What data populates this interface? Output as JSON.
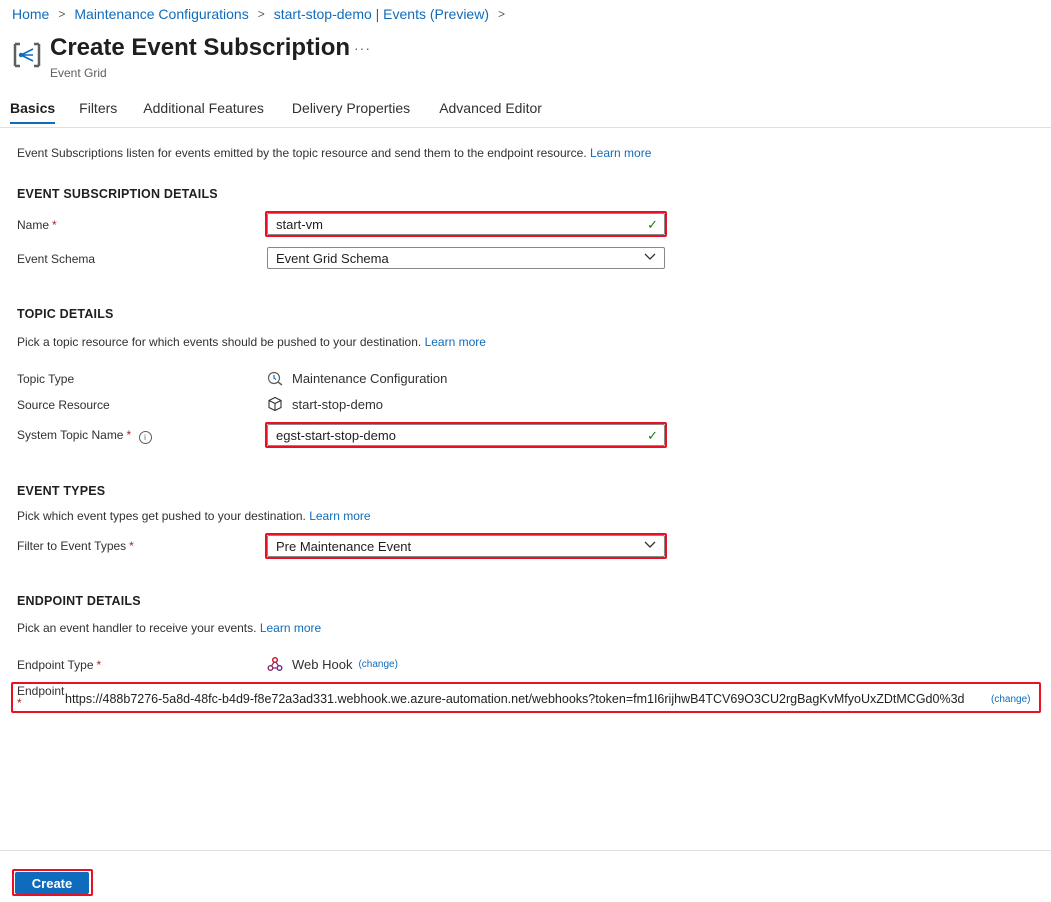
{
  "breadcrumb": [
    "Home",
    "Maintenance Configurations",
    "start-stop-demo | Events (Preview)"
  ],
  "header": {
    "title": "Create Event Subscription",
    "subtitle": "Event Grid",
    "more": "···"
  },
  "tabs": [
    "Basics",
    "Filters",
    "Additional Features",
    "Delivery Properties",
    "Advanced Editor"
  ],
  "intro": {
    "text": "Event Subscriptions listen for events emitted by the topic resource and send them to the endpoint resource.",
    "link": "Learn more"
  },
  "subscription_details": {
    "heading": "EVENT SUBSCRIPTION DETAILS",
    "name_label": "Name",
    "name_value": "start-vm",
    "schema_label": "Event Schema",
    "schema_value": "Event Grid Schema"
  },
  "topic_details": {
    "heading": "TOPIC DETAILS",
    "desc": "Pick a topic resource for which events should be pushed to your destination.",
    "link": "Learn more",
    "topic_type_label": "Topic Type",
    "topic_type_value": "Maintenance Configuration",
    "source_label": "Source Resource",
    "source_value": "start-stop-demo",
    "system_topic_label": "System Topic Name",
    "system_topic_value": "egst-start-stop-demo"
  },
  "event_types": {
    "heading": "EVENT TYPES",
    "desc": "Pick which event types get pushed to your destination.",
    "link": "Learn more",
    "filter_label": "Filter to Event Types",
    "filter_value": "Pre Maintenance Event"
  },
  "endpoint_details": {
    "heading": "ENDPOINT DETAILS",
    "desc": "Pick an event handler to receive your events.",
    "link": "Learn more",
    "type_label": "Endpoint Type",
    "type_value": "Web Hook",
    "change": "(change)",
    "endpoint_label": "Endpoint",
    "endpoint_value": "https://488b7276-5a8d-48fc-b4d9-f8e72a3ad331.webhook.we.azure-automation.net/webhooks?token=fm1I6rijhwB4TCV69O3CU2rgBagKvMfyoUxZDtMCGd0%3d",
    "endpoint_change": "(change)"
  },
  "required_mark": "*",
  "footer": {
    "create_label": "Create"
  },
  "colors": {
    "accent": "#0f6cbd",
    "highlight": "#e81123",
    "required": "#a4262c",
    "valid": "#107c10"
  }
}
